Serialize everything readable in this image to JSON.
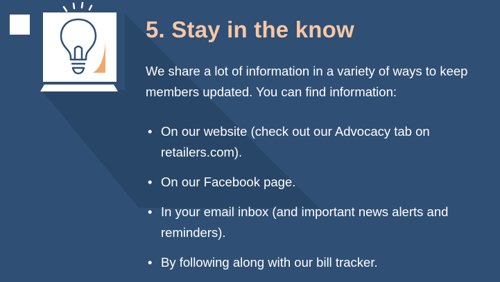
{
  "colors": {
    "background": "#2f4f74",
    "heading": "#f7c7a4",
    "text": "#ffffff",
    "accent": "#f0a868"
  },
  "section": {
    "heading": "5. Stay in the know",
    "intro": "We share a lot of information in a variety of ways to keep members updated. You can find information:",
    "bullets": [
      "On our website (check out our Advocacy tab on retailers.com).",
      "On our Facebook page.",
      "In your email inbox (and important news alerts and reminders).",
      "By following along with our bill tracker."
    ]
  },
  "icons": {
    "main": "lightbulb-monitor-icon",
    "corner": "square-marker-icon"
  }
}
